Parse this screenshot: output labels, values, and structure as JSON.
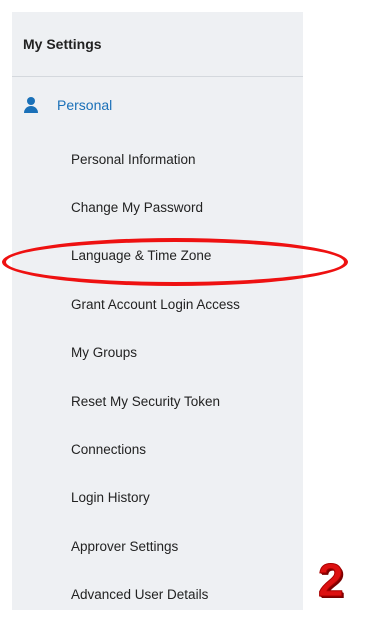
{
  "panel": {
    "title": "My Settings"
  },
  "section": {
    "label": "Personal",
    "icon": "person-icon",
    "color": "#1a70b8"
  },
  "items": [
    {
      "label": "Personal Information"
    },
    {
      "label": "Change My Password"
    },
    {
      "label": "Language & Time Zone"
    },
    {
      "label": "Grant Account Login Access"
    },
    {
      "label": "My Groups"
    },
    {
      "label": "Reset My Security Token"
    },
    {
      "label": "Connections"
    },
    {
      "label": "Login History"
    },
    {
      "label": "Approver Settings"
    },
    {
      "label": "Advanced User Details"
    }
  ],
  "annotation": {
    "step_number": "2",
    "highlight_color": "#ee1111",
    "highlighted_item": "Language & Time Zone"
  }
}
